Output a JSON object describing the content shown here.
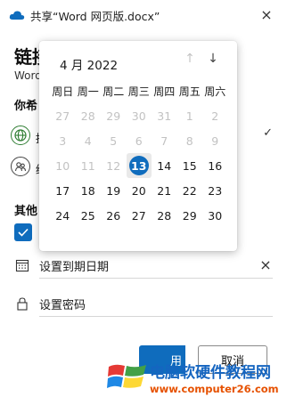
{
  "window": {
    "title": "共享“Word 网页版.docx”",
    "close_icon": "×"
  },
  "background": {
    "heading": "链接",
    "subtitle": "Word",
    "section_you_want": "你希",
    "option1_label": "拥",
    "option2_label": "给",
    "section_other": "其他"
  },
  "expiry": {
    "label": "设置到期日期",
    "clear_icon": "×"
  },
  "password": {
    "label": "设置密码"
  },
  "buttons": {
    "apply_label": "用",
    "cancel_label": "取消"
  },
  "calendar": {
    "month_label": "4 月 2022",
    "weekdays": [
      "周日",
      "周一",
      "周二",
      "周三",
      "周四",
      "周五",
      "周六"
    ],
    "selected_day": "13",
    "rows": [
      [
        {
          "d": "27",
          "disabled": true
        },
        {
          "d": "28",
          "disabled": true
        },
        {
          "d": "29",
          "disabled": true
        },
        {
          "d": "30",
          "disabled": true
        },
        {
          "d": "31",
          "disabled": true
        },
        {
          "d": "1",
          "disabled": true
        },
        {
          "d": "2",
          "disabled": true
        }
      ],
      [
        {
          "d": "3",
          "disabled": true
        },
        {
          "d": "4",
          "disabled": true
        },
        {
          "d": "5",
          "disabled": true
        },
        {
          "d": "6",
          "disabled": true
        },
        {
          "d": "7",
          "disabled": true
        },
        {
          "d": "8",
          "disabled": true
        },
        {
          "d": "9",
          "disabled": true
        }
      ],
      [
        {
          "d": "10",
          "disabled": true
        },
        {
          "d": "11",
          "disabled": true
        },
        {
          "d": "12",
          "disabled": true
        },
        {
          "d": "13",
          "disabled": false,
          "selected": true
        },
        {
          "d": "14",
          "disabled": false
        },
        {
          "d": "15",
          "disabled": false
        },
        {
          "d": "16",
          "disabled": false
        }
      ],
      [
        {
          "d": "17",
          "disabled": false
        },
        {
          "d": "18",
          "disabled": false
        },
        {
          "d": "19",
          "disabled": false
        },
        {
          "d": "20",
          "disabled": false
        },
        {
          "d": "21",
          "disabled": false
        },
        {
          "d": "22",
          "disabled": false
        },
        {
          "d": "23",
          "disabled": false
        }
      ],
      [
        {
          "d": "24",
          "disabled": false
        },
        {
          "d": "25",
          "disabled": false
        },
        {
          "d": "26",
          "disabled": false
        },
        {
          "d": "27",
          "disabled": false
        },
        {
          "d": "28",
          "disabled": false
        },
        {
          "d": "29",
          "disabled": false
        },
        {
          "d": "30",
          "disabled": false
        }
      ]
    ]
  },
  "watermark": {
    "text": "电脑软硬件教程网",
    "url": "www.computer26.com"
  },
  "colors": {
    "accent": "#0f6cbd",
    "disabled_text": "#c2c2c2"
  }
}
